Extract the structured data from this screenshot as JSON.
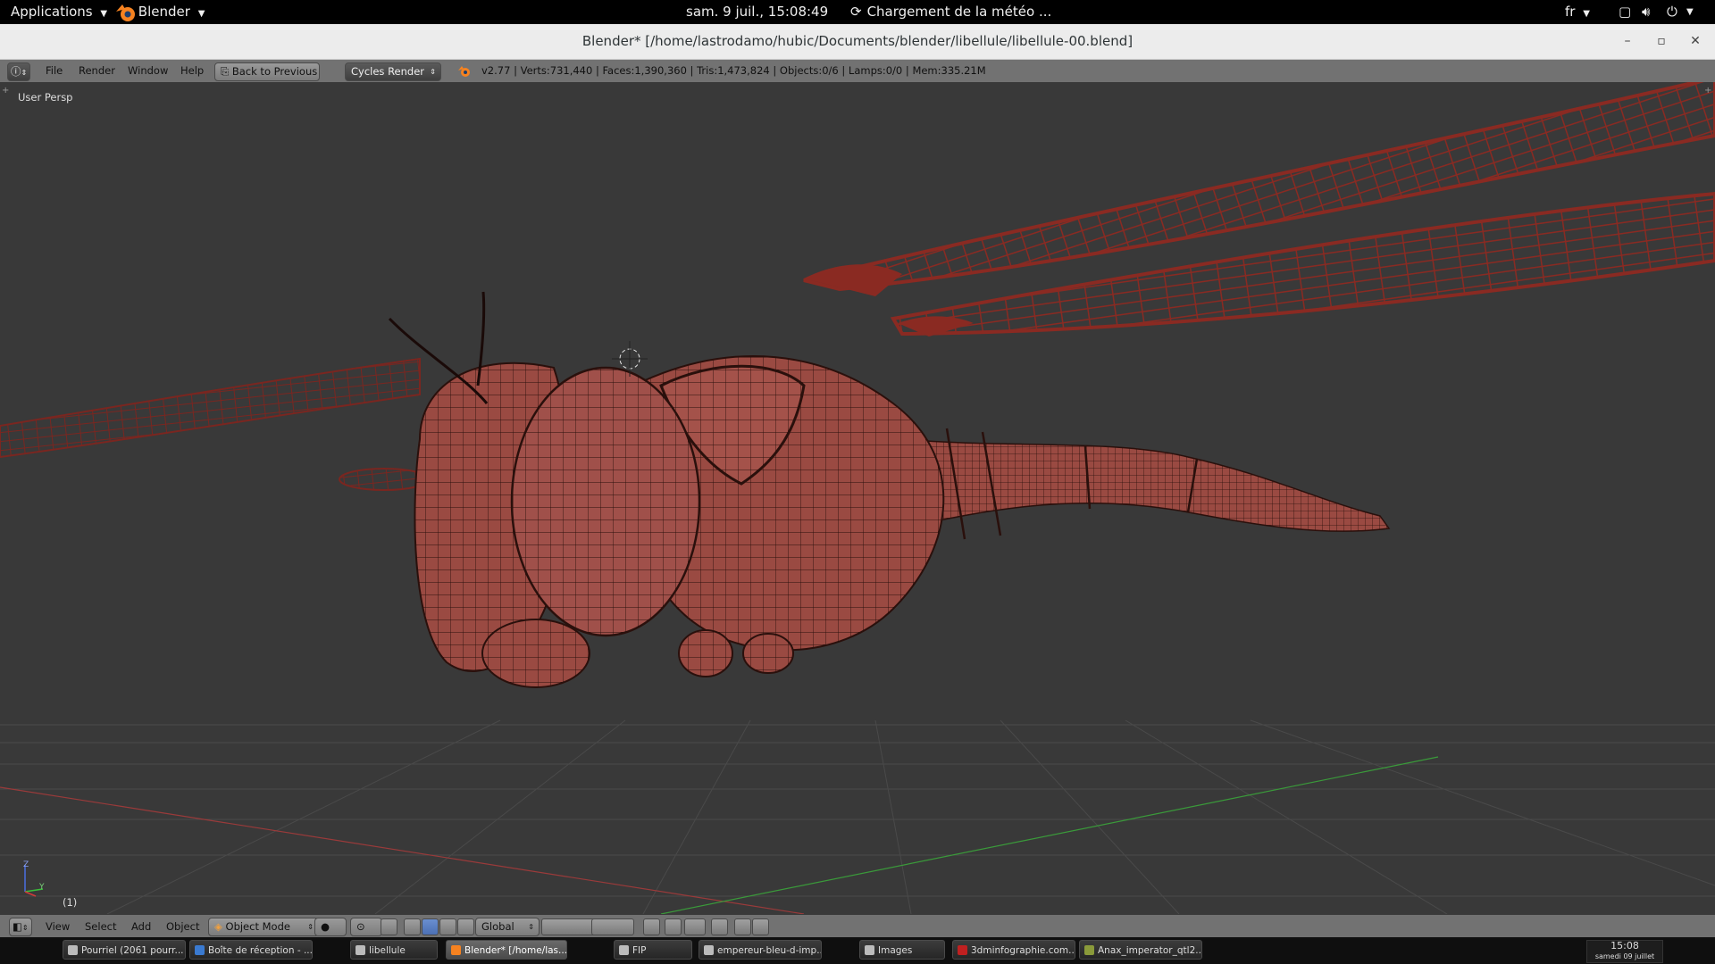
{
  "gnome": {
    "applications": "Applications",
    "app_menu": "Blender",
    "datetime": "sam.  9 juil., 15:08:49",
    "weather": "Chargement de la météo ...",
    "keyboard": "fr"
  },
  "window": {
    "title": "Blender* [/home/lastrodamo/hubic/Documents/blender/libellule/libellule-00.blend]"
  },
  "info_header": {
    "menus": [
      "File",
      "Render",
      "Window",
      "Help"
    ],
    "back_button": "Back to Previous",
    "render_engine": "Cycles Render",
    "stats": "v2.77 | Verts:731,440 | Faces:1,390,360 | Tris:1,473,824 | Objects:0/6 | Lamps:0/0 | Mem:335.21M"
  },
  "viewport": {
    "view_name": "User Persp",
    "frame_label": "(1)",
    "axis_z": "Z",
    "axis_y": "Y",
    "colors": {
      "background": "#393939",
      "model": "#9a4a42",
      "wireframe": "#2a100c",
      "wings": "#8a2a22",
      "x_axis": "#9a3a3a",
      "y_axis": "#3a9a3a"
    }
  },
  "footer": {
    "menus": [
      "View",
      "Select",
      "Add",
      "Object"
    ],
    "mode": "Object Mode",
    "orientation": "Global"
  },
  "taskbar": {
    "tasks": [
      {
        "label": "Pourriel (2061 pourr...",
        "icon": "mail-icon",
        "active": false
      },
      {
        "label": "Boîte de réception - ...",
        "icon": "browser-icon",
        "active": false
      },
      {
        "label": "libellule",
        "icon": "folder-icon",
        "active": false
      },
      {
        "label": "Blender* [/home/las...",
        "icon": "blender-icon",
        "active": true
      },
      {
        "label": "FIP",
        "icon": "radio-icon",
        "active": false
      },
      {
        "label": "empereur-bleu-d-imp...",
        "icon": "document-icon",
        "active": false
      },
      {
        "label": "Images",
        "icon": "folder-icon",
        "active": false
      },
      {
        "label": "3dminfographie.com...",
        "icon": "filezilla-icon",
        "active": false
      },
      {
        "label": "Anax_imperator_qtl2...",
        "icon": "image-icon",
        "active": false
      }
    ],
    "clock_time": "15:08",
    "clock_date": "samedi 09 juillet"
  }
}
